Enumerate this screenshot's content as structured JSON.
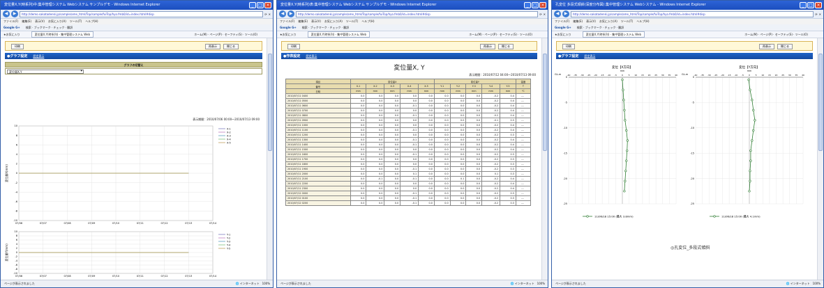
{
  "windows": [
    {
      "title": "変位量X,Y(時系列)中:集中管理システム Webシステム サンプルデモ - Windows Internet Explorer"
    },
    {
      "title": "変位量X,Y(時系列)表:集中管理システム Webシステム サンプルデモ - Windows Internet Explorer"
    },
    {
      "title": "孔変位 多段式傾斜(深度分布図):集中管理システム Webシステム - Windows Internet Explorer"
    }
  ],
  "browser": {
    "url": "http://demo.sakatadenki.jp/sample/ame_html/Top/sample/fuiTop/hyo.fmb0/id=index.html#disp",
    "search_placeholder": "Google",
    "menu": [
      "ファイル(F)",
      "編集(E)",
      "表示(V)",
      "お気に入り(A)",
      "ツール(T)",
      "ヘルプ(H)"
    ],
    "toolbar": [
      "Google G+",
      "検索",
      "ブックマーク",
      "チェック",
      "翻訳",
      "設定"
    ],
    "favorites_label": "お気に入り",
    "tab_label": "変位量X,Y(時系列) - 集中管理システム Web",
    "favright": "ホーム(M) · ページ(P) · セーフティ(S) · ツール(O)",
    "status_left": "ページが表示されました",
    "status_zone": "インターネット",
    "zoom": "100%"
  },
  "common": {
    "print_button": "印刷",
    "redisplay_button": "再表示",
    "close_button": "閉じる",
    "settings_link": "設定表示"
  },
  "graph_window": {
    "section_title": "●グラフ設定",
    "panel_header": "グラフの切替え",
    "select_value": "変位量X,Y",
    "period": "表示期間：2010/07/06 00:00～2010/07/13 09:00",
    "chart_data": [
      {
        "type": "line",
        "ylabel": "変位量X(mm)",
        "categories": [
          "07/06",
          "07/07",
          "07/08",
          "07/09",
          "07/10",
          "07/11",
          "07/12",
          "07/13",
          "07/14"
        ],
        "ylim": [
          -10,
          10
        ],
        "yticks": [
          10,
          8,
          6,
          4,
          2,
          0,
          -2,
          -4,
          -6,
          -8,
          -10
        ],
        "series": [
          {
            "name": "X-1",
            "color": "#8080c0",
            "values": [
              0,
              0,
              0,
              0,
              0,
              0,
              0,
              0
            ]
          },
          {
            "name": "X-2",
            "color": "#c080c0",
            "values": [
              0,
              0,
              0,
              0,
              0,
              0,
              0,
              0
            ]
          },
          {
            "name": "X-3",
            "color": "#60a0c0",
            "values": [
              0,
              0,
              0,
              0,
              0,
              0,
              0,
              0
            ]
          },
          {
            "name": "X-4",
            "color": "#80c080",
            "values": [
              0,
              0,
              0,
              0,
              0,
              0,
              0,
              0
            ]
          },
          {
            "name": "X-5",
            "color": "#c0a060",
            "values": [
              0,
              0,
              0,
              0,
              0,
              0,
              0,
              0
            ]
          }
        ]
      },
      {
        "type": "line",
        "ylabel": "変位量Y(mm)",
        "categories": [
          "07/06",
          "07/07",
          "07/08",
          "07/09",
          "07/10",
          "07/11",
          "07/12",
          "07/13",
          "07/14"
        ],
        "ylim": [
          -10,
          10
        ],
        "yticks": [
          10,
          8,
          6,
          4,
          2,
          0,
          -2,
          -4,
          -6,
          -8,
          -10
        ],
        "series": [
          {
            "name": "Y-1",
            "color": "#8080c0",
            "values": [
              0,
              0,
              0,
              0,
              0,
              0,
              0,
              0
            ]
          },
          {
            "name": "Y-2",
            "color": "#c080c0",
            "values": [
              0,
              0,
              0,
              0,
              0,
              0,
              0,
              0
            ]
          },
          {
            "name": "Y-3",
            "color": "#60a0c0",
            "values": [
              0,
              0,
              0,
              0,
              0,
              0,
              0,
              0
            ]
          },
          {
            "name": "Y-4",
            "color": "#80c080",
            "values": [
              0,
              0,
              0,
              0,
              0,
              0,
              0,
              0
            ]
          },
          {
            "name": "Y-5",
            "color": "#c0a060",
            "values": [
              0,
              0,
              0,
              0,
              0,
              0,
              0,
              0
            ]
          }
        ]
      }
    ]
  },
  "table_window": {
    "section_title": "●作表設定",
    "table_title": "変位量X, Y",
    "period": "表示期間：2010/07/12 04:00～2010/07/13 09:00",
    "chart_data": {
      "type": "table",
      "header_top": [
        "項目",
        "変位量X",
        "変位量Y",
        "温度"
      ],
      "header_sub": [
        "番号",
        "X-1",
        "X-2",
        "X-3",
        "X-4",
        "X-5",
        "Y-1",
        "Y-2",
        "Y-3",
        "Y-4",
        "Y-5",
        "T"
      ],
      "header_unit": [
        "日時",
        "mm",
        "mm",
        "mm",
        "mm",
        "mm",
        "mm",
        "mm",
        "mm",
        "mm",
        "mm",
        "℃"
      ],
      "rows": [
        [
          "2010/07/11 0400",
          "0.0",
          "0.0",
          "0.0",
          "0.0",
          "0.0",
          "0.0",
          "0.0",
          "0.0",
          "-0.2",
          "0.4",
          "---"
        ],
        [
          "2010/07/11 0500",
          "0.0",
          "0.0",
          "0.0",
          "0.0",
          "0.0",
          "0.0",
          "0.0",
          "0.0",
          "-0.2",
          "0.4",
          "---"
        ],
        [
          "2010/07/11 0600",
          "0.0",
          "0.0",
          "0.0",
          "-0.1",
          "0.0",
          "0.0",
          "0.0",
          "0.0",
          "-0.2",
          "0.4",
          "---"
        ],
        [
          "2010/07/11 0700",
          "0.0",
          "0.0",
          "0.0",
          "0.0",
          "0.0",
          "0.0",
          "0.0",
          "0.0",
          "-0.2",
          "0.4",
          "---"
        ],
        [
          "2010/07/11 0800",
          "0.0",
          "0.0",
          "0.0",
          "-0.1",
          "0.0",
          "0.0",
          "0.0",
          "0.0",
          "-0.2",
          "0.4",
          "---"
        ],
        [
          "2010/07/11 0900",
          "0.0",
          "0.0",
          "0.0",
          "0.0",
          "0.0",
          "0.0",
          "0.0",
          "0.0",
          "-0.1",
          "0.3",
          "---"
        ],
        [
          "2010/07/11 1000",
          "0.0",
          "0.0",
          "0.0",
          "0.0",
          "0.0",
          "0.0",
          "0.0",
          "0.0",
          "-0.2",
          "0.4",
          "---"
        ],
        [
          "2010/07/11 1100",
          "0.0",
          "0.0",
          "0.0",
          "-0.1",
          "0.0",
          "0.0",
          "0.0",
          "0.0",
          "-0.2",
          "0.4",
          "---"
        ],
        [
          "2010/07/11 1200",
          "0.0",
          "0.0",
          "0.0",
          "0.0",
          "0.0",
          "0.0",
          "0.0",
          "0.0",
          "-0.2",
          "0.3",
          "---"
        ],
        [
          "2010/07/11 1300",
          "0.0",
          "0.0",
          "0.0",
          "-0.1",
          "0.0",
          "0.0",
          "0.0",
          "0.0",
          "-0.2",
          "0.4",
          "---"
        ],
        [
          "2010/07/11 1400",
          "0.0",
          "0.0",
          "0.0",
          "-0.1",
          "0.0",
          "0.0",
          "0.0",
          "0.0",
          "-0.2",
          "0.4",
          "---"
        ],
        [
          "2010/07/11 1500",
          "0.0",
          "0.0",
          "0.0",
          "0.0",
          "0.0",
          "0.0",
          "0.0",
          "0.0",
          "-0.2",
          "0.4",
          "---"
        ],
        [
          "2010/07/11 1600",
          "0.0",
          "0.0",
          "0.0",
          "-0.1",
          "0.0",
          "0.0",
          "0.0",
          "0.0",
          "-0.2",
          "0.3",
          "---"
        ],
        [
          "2010/07/11 1700",
          "0.0",
          "0.0",
          "0.0",
          "0.0",
          "0.0",
          "0.0",
          "0.0",
          "0.0",
          "-0.2",
          "0.3",
          "---"
        ],
        [
          "2010/07/11 1800",
          "0.0",
          "0.0",
          "0.0",
          "0.0",
          "0.0",
          "0.0",
          "0.0",
          "0.0",
          "-0.2",
          "0.3",
          "---"
        ],
        [
          "2010/07/11 1900",
          "0.0",
          "0.0",
          "0.0",
          "-0.1",
          "0.0",
          "0.0",
          "0.0",
          "0.0",
          "-0.2",
          "0.3",
          "---"
        ],
        [
          "2010/07/11 2000",
          "0.0",
          "0.0",
          "0.0",
          "0.1",
          "0.0",
          "0.0",
          "0.0",
          "0.0",
          "0.1",
          "0.3",
          "---"
        ],
        [
          "2010/07/11 2100",
          "0.0",
          "-0.1",
          "0.0",
          "-0.1",
          "0.0",
          "0.0",
          "0.1",
          "0.0",
          "-0.2",
          "0.4",
          "---"
        ],
        [
          "2010/07/11 2200",
          "0.0",
          "0.0",
          "0.0",
          "0.0",
          "0.0",
          "0.0",
          "0.0",
          "0.0",
          "-0.2",
          "0.4",
          "---"
        ],
        [
          "2010/07/11 2300",
          "0.0",
          "0.0",
          "0.0",
          "0.0",
          "0.0",
          "0.0",
          "0.0",
          "0.0",
          "-0.2",
          "0.4",
          "---"
        ],
        [
          "2010/07/12 0000",
          "0.0",
          "0.0",
          "0.0",
          "-0.1",
          "0.0",
          "0.0",
          "0.0",
          "0.0",
          "-0.2",
          "0.3",
          "---"
        ],
        [
          "2010/07/12 0100",
          "0.0",
          "0.0",
          "0.0",
          "-0.1",
          "0.0",
          "0.0",
          "0.0",
          "0.0",
          "-0.2",
          "0.3",
          "---"
        ],
        [
          "2010/07/12 0200",
          "0.0",
          "0.0",
          "0.0",
          "-0.1",
          "0.0",
          "0.0",
          "0.0",
          "0.0",
          "-0.2",
          "0.3",
          "---"
        ]
      ]
    }
  },
  "profile_window": {
    "section_title": "●グラフ設定",
    "caption": "◎孔変位_多段式傾斜",
    "chart_data": [
      {
        "type": "line",
        "title": "変位【X方向】",
        "unit": "mm",
        "ylabel": "GL-m",
        "xlim": [
          -40,
          40
        ],
        "ylim": [
          -25,
          0
        ],
        "xticks": [
          -40,
          -35,
          -30,
          -25,
          -20,
          -15,
          -10,
          -5,
          0,
          5,
          10,
          15,
          20,
          25,
          30,
          35,
          40
        ],
        "yticks": [
          0,
          -5,
          -10,
          -15,
          -20,
          -25
        ],
        "series": [
          {
            "name": "11/06/18 15:00 (最大 3.8mm)",
            "color": "#2e7d32",
            "points": [
              [
                0,
                -0.5
              ],
              [
                0.5,
                -2.5
              ],
              [
                1,
                -4.5
              ],
              [
                1.5,
                -6.5
              ],
              [
                2,
                -8.5
              ],
              [
                3,
                -10.5
              ],
              [
                3.8,
                -12.5
              ],
              [
                3.5,
                -14.5
              ],
              [
                3,
                -16.5
              ],
              [
                2.5,
                -18.5
              ],
              [
                2,
                -20.5
              ],
              [
                1.5,
                -22.5
              ]
            ]
          }
        ]
      },
      {
        "type": "line",
        "title": "変位【Y方向】",
        "unit": "mm",
        "ylabel": "GL-m",
        "xlim": [
          -40,
          40
        ],
        "ylim": [
          -25,
          0
        ],
        "xticks": [
          -40,
          -35,
          -30,
          -25,
          -20,
          -15,
          -10,
          -5,
          0,
          5,
          10,
          15,
          20,
          25,
          30,
          35,
          40
        ],
        "yticks": [
          0,
          -5,
          -10,
          -15,
          -20,
          -25
        ],
        "series": [
          {
            "name": "11/06/18 15:00 (最大 4.1mm)",
            "color": "#2e7d32",
            "points": [
              [
                -0.5,
                -0.5
              ],
              [
                0.5,
                -2.5
              ],
              [
                2,
                -4.5
              ],
              [
                3,
                -6.5
              ],
              [
                4.1,
                -8.5
              ],
              [
                3,
                -10.5
              ],
              [
                2,
                -12.5
              ],
              [
                1,
                -14.5
              ],
              [
                1,
                -16.5
              ],
              [
                0.5,
                -18.5
              ],
              [
                0.5,
                -20.5
              ],
              [
                0,
                -22.5
              ]
            ]
          }
        ]
      }
    ]
  }
}
